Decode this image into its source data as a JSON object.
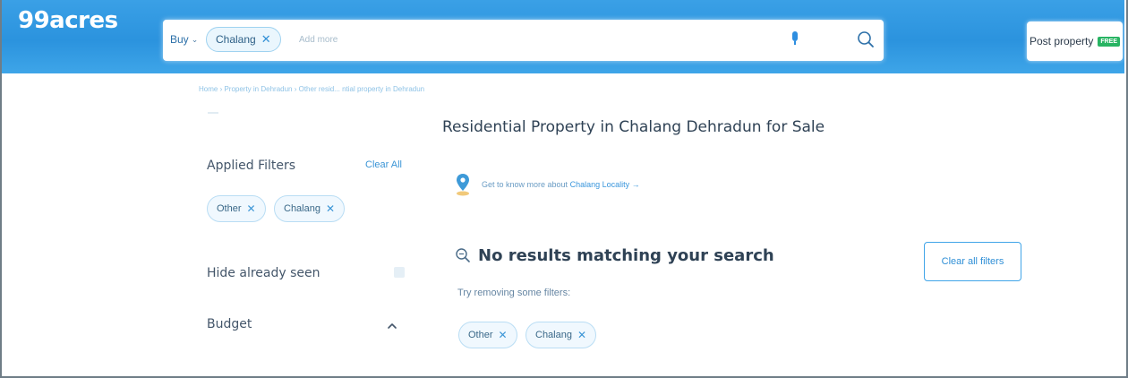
{
  "header": {
    "logo": "99acres",
    "buy_label": "Buy",
    "search_chip": "Chalang",
    "search_placeholder": "Add more",
    "post_property_label": "Post property",
    "free_badge": "FREE"
  },
  "breadcrumb": "Home › Property in Dehradun › Other resid... ntial property in Dehradun",
  "page_title": "Residential Property in Chalang Dehradun for Sale",
  "filters": {
    "applied_label": "Applied Filters",
    "clear_all_label": "Clear All",
    "chips": [
      "Other",
      "Chalang"
    ],
    "hide_seen_label": "Hide already seen",
    "budget_label": "Budget"
  },
  "locality": {
    "text": "Get to know more about",
    "link": "Chalang Locality →"
  },
  "results": {
    "no_results_title": "No results matching your search",
    "try_text": "Try removing some filters:",
    "chips": [
      "Other",
      "Chalang"
    ],
    "clear_filters_label": "Clear all filters"
  },
  "colors": {
    "header_blue": "#2b93de",
    "accent": "#3b95d6",
    "free_badge": "#28b463"
  }
}
